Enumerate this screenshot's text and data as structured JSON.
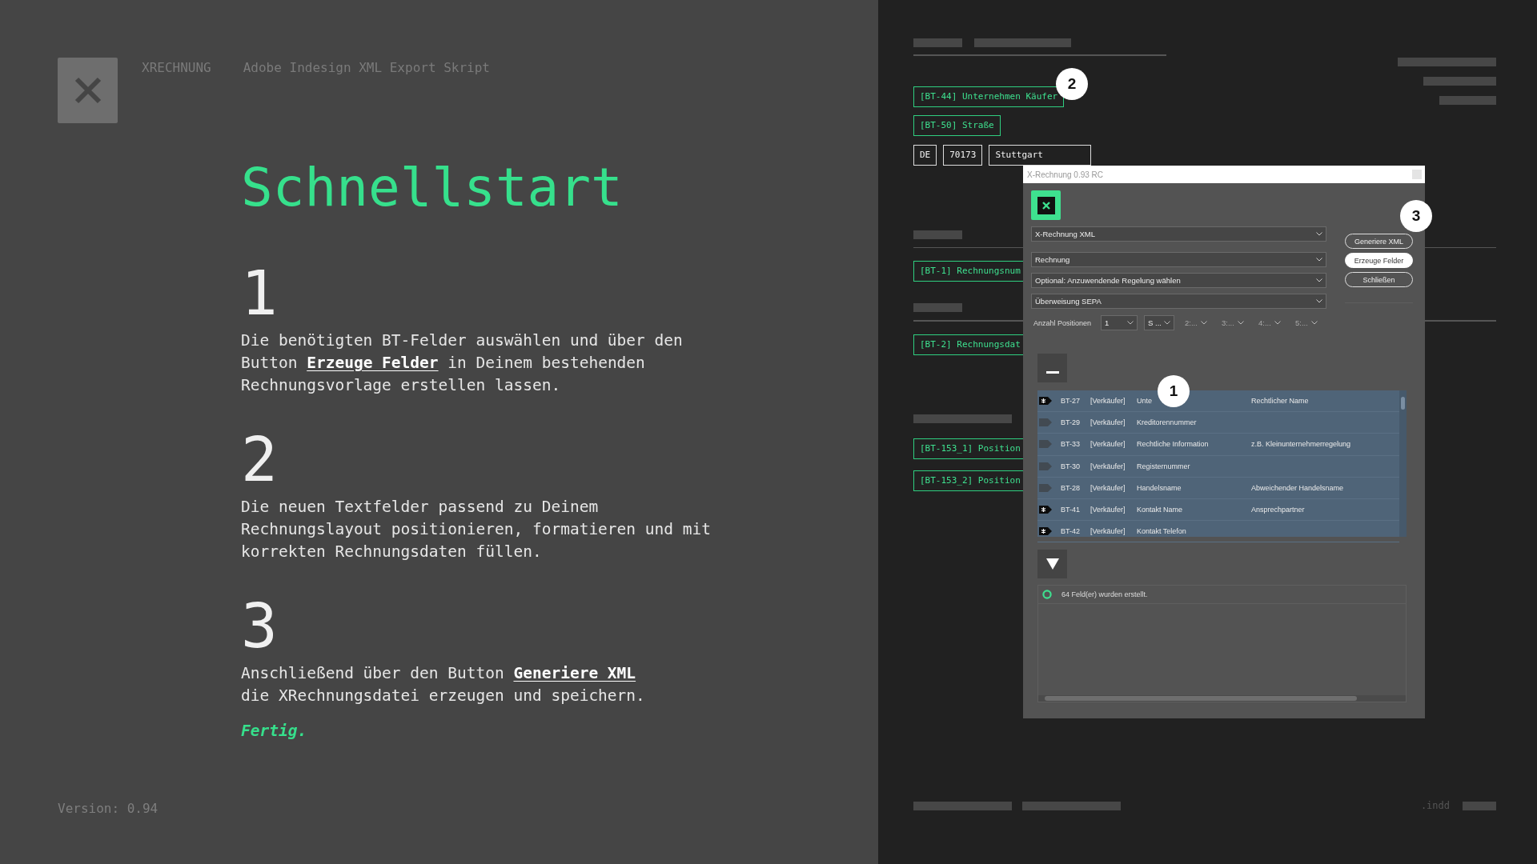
{
  "header": {
    "brand": "XRECHNUNG",
    "subtitle": "Adobe Indesign XML Export Skript"
  },
  "title": "Schnellstart",
  "steps": [
    {
      "number": "1",
      "parts": [
        {
          "kind": "text",
          "text": "Die benötigten BT-Felder auswählen und über den\nButton "
        },
        {
          "kind": "link",
          "text": "Erzeuge Felder"
        },
        {
          "kind": "text",
          "text": " in Deinem bestehenden\nRechnungsvorlage erstellen lassen."
        }
      ]
    },
    {
      "number": "2",
      "parts": [
        {
          "kind": "text",
          "text": "Die neuen Textfelder passend zu Deinem\nRechnungslayout positionieren, formatieren und mit\nkorrekten Rechnungsdaten füllen."
        }
      ]
    },
    {
      "number": "3",
      "parts": [
        {
          "kind": "text",
          "text": "Anschließend über den Button "
        },
        {
          "kind": "link",
          "text": "Generiere XML"
        },
        {
          "kind": "text",
          "text": "\ndie XRechnungsdatei erzeugen und speichern."
        }
      ]
    }
  ],
  "done": "Fertig.",
  "version": "Version: 0.94",
  "document": {
    "fields": [
      "[BT-44] Unternehmen Käufer",
      "[BT-50] Straße",
      "[BT-1] Rechnungsnum",
      "[BT-2] Rechnungsdat",
      "[BT-153_1] Position",
      "[BT-153_2] Position"
    ],
    "address": [
      "DE",
      "70173",
      "Stuttgart"
    ],
    "file_ext": ".indd"
  },
  "dialog": {
    "title": "X-Rechnung 0.93 RC",
    "selects": [
      "X-Rechnung XML",
      "Rechnung",
      "Optional: Anzuwendende Regelung wählen",
      "Überweisung SEPA"
    ],
    "positions_label": "Anzahl Positionen",
    "positions": [
      {
        "value": "1",
        "disabled": false
      },
      {
        "value": "S ...",
        "disabled": false
      },
      {
        "value": "2:...",
        "disabled": true
      },
      {
        "value": "3:...",
        "disabled": true
      },
      {
        "value": "4:...",
        "disabled": true
      },
      {
        "value": "5:...",
        "disabled": true
      }
    ],
    "buttons": [
      {
        "label": "Generiere XML",
        "primary": false
      },
      {
        "label": "Erzeuge Felder",
        "primary": true
      },
      {
        "label": "Schließen",
        "primary": false
      }
    ],
    "rows": [
      {
        "required": true,
        "id": "BT-27",
        "role": "[Verkäufer]",
        "name": "Unte",
        "description": "Rechtlicher Name"
      },
      {
        "required": false,
        "id": "BT-29",
        "role": "[Verkäufer]",
        "name": "Kreditorennummer"
      },
      {
        "required": false,
        "id": "BT-33",
        "role": "[Verkäufer]",
        "name": "Rechtliche Information",
        "description": "z.B. Kleinunternehmerregelung"
      },
      {
        "required": false,
        "id": "BT-30",
        "role": "[Verkäufer]",
        "name": "Registernummer"
      },
      {
        "required": false,
        "id": "BT-28",
        "role": "[Verkäufer]",
        "name": "Handelsname",
        "description": "Abweichender Handelsname"
      },
      {
        "required": true,
        "id": "BT-41",
        "role": "[Verkäufer]",
        "name": "Kontakt Name",
        "description": "Ansprechpartner"
      },
      {
        "required": true,
        "id": "BT-42",
        "role": "[Verkäufer]",
        "name": "Kontakt Telefon"
      }
    ],
    "log": [
      "64 Feld(er) wurden erstellt."
    ]
  },
  "callouts": [
    "1",
    "2",
    "3"
  ]
}
